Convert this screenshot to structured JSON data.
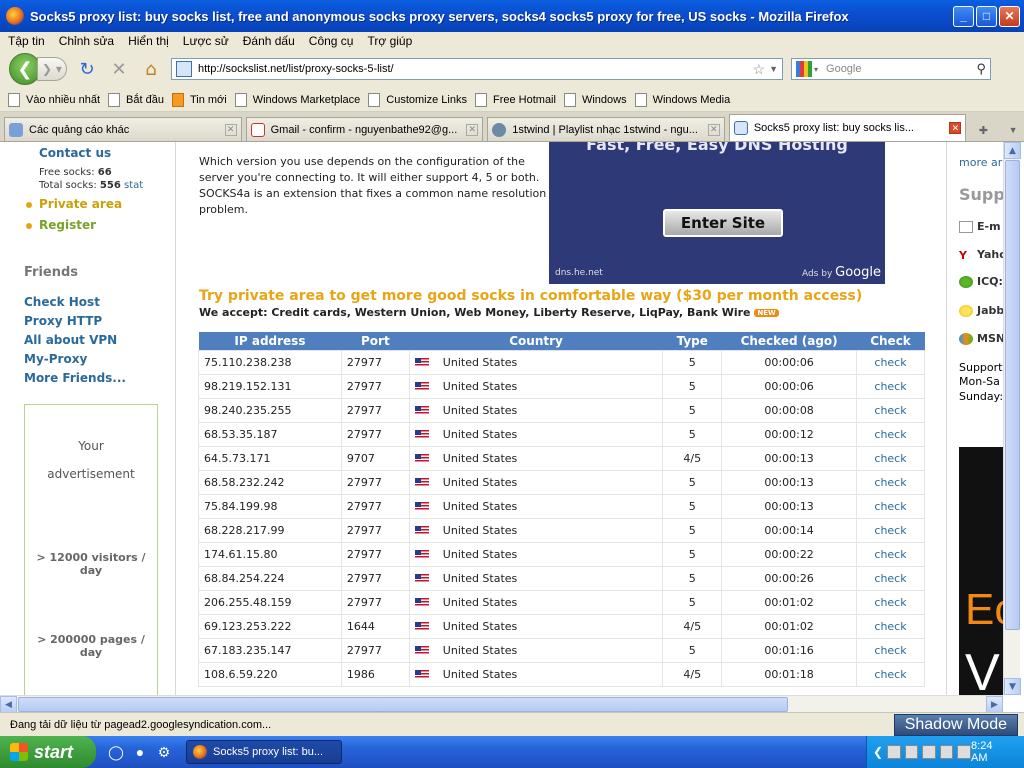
{
  "window": {
    "title": "Socks5 proxy list: buy socks list, free and anonymous socks proxy servers, socks4 socks5 proxy for free, US socks - Mozilla Firefox",
    "minimize": "_",
    "maximize": "□",
    "close": "✕"
  },
  "menu": [
    "Tập tin",
    "Chỉnh sửa",
    "Hiển thị",
    "Lược sử",
    "Đánh dấu",
    "Công cụ",
    "Trợ giúp"
  ],
  "nav": {
    "url": "http://sockslist.net/list/proxy-socks-5-list/",
    "search_placeholder": "Google"
  },
  "bookmarks": [
    "Vào nhiều nhất",
    "Bắt đầu",
    "Tin mới",
    "Windows Marketplace",
    "Customize Links",
    "Free Hotmail",
    "Windows",
    "Windows Media"
  ],
  "tabs": [
    {
      "label": "Các quảng cáo khác"
    },
    {
      "label": "Gmail - confirm - nguyenbathe92@g..."
    },
    {
      "label": "1stwind | Playlist nhạc 1stwind - ngu..."
    },
    {
      "label": "Socks5 proxy list: buy socks lis..."
    }
  ],
  "sidebar": {
    "contact": "Contact us",
    "free_socks_label": "Free socks:",
    "free_socks": "66",
    "total_socks_label": "Total socks:",
    "total_socks": "556",
    "stat": "stat",
    "private": "Private area",
    "register": "Register",
    "friends_title": "Friends",
    "friends": [
      "Check Host",
      "Proxy HTTP",
      "All about VPN",
      "My-Proxy",
      "More Friends..."
    ],
    "ad": {
      "line1": "Your",
      "line2": "advertisement",
      "visitors": "> 12000 visitors / day",
      "pages": "> 200000 pages / day"
    }
  },
  "main": {
    "desc": "Which version you use depends on the configuration of the server you're connecting to. It will either support 4, 5 or both. SOCKS4a is an extension that fixes a common name resolution problem.",
    "ad": {
      "headline": "Fast, Free, Easy DNS Hosting",
      "button": "Enter Site",
      "domain": "dns.he.net",
      "ads_by": "Ads by",
      "google": "Google"
    },
    "promo": "Try private area to get more good socks in comfortable way ($30 per month access)",
    "accept": "We accept: Credit cards, Western Union, Web Money, Liberty Reserve, LiqPay, Bank Wire",
    "new_badge": "NEW"
  },
  "table": {
    "headers": [
      "IP address",
      "Port",
      "Country",
      "Type",
      "Checked (ago)",
      "Check"
    ],
    "rows": [
      {
        "ip": "75.110.238.238",
        "port": "27977",
        "country": "United States",
        "type": "5",
        "checked": "00:00:06",
        "check": "check"
      },
      {
        "ip": "98.219.152.131",
        "port": "27977",
        "country": "United States",
        "type": "5",
        "checked": "00:00:06",
        "check": "check"
      },
      {
        "ip": "98.240.235.255",
        "port": "27977",
        "country": "United States",
        "type": "5",
        "checked": "00:00:08",
        "check": "check"
      },
      {
        "ip": "68.53.35.187",
        "port": "27977",
        "country": "United States",
        "type": "5",
        "checked": "00:00:12",
        "check": "check"
      },
      {
        "ip": "64.5.73.171",
        "port": "9707",
        "country": "United States",
        "type": "4/5",
        "checked": "00:00:13",
        "check": "check"
      },
      {
        "ip": "68.58.232.242",
        "port": "27977",
        "country": "United States",
        "type": "5",
        "checked": "00:00:13",
        "check": "check"
      },
      {
        "ip": "75.84.199.98",
        "port": "27977",
        "country": "United States",
        "type": "5",
        "checked": "00:00:13",
        "check": "check"
      },
      {
        "ip": "68.228.217.99",
        "port": "27977",
        "country": "United States",
        "type": "5",
        "checked": "00:00:14",
        "check": "check"
      },
      {
        "ip": "174.61.15.80",
        "port": "27977",
        "country": "United States",
        "type": "5",
        "checked": "00:00:22",
        "check": "check"
      },
      {
        "ip": "68.84.254.224",
        "port": "27977",
        "country": "United States",
        "type": "5",
        "checked": "00:00:26",
        "check": "check"
      },
      {
        "ip": "206.255.48.159",
        "port": "27977",
        "country": "United States",
        "type": "5",
        "checked": "00:01:02",
        "check": "check"
      },
      {
        "ip": "69.123.253.222",
        "port": "1644",
        "country": "United States",
        "type": "4/5",
        "checked": "00:01:02",
        "check": "check"
      },
      {
        "ip": "67.183.235.147",
        "port": "27977",
        "country": "United States",
        "type": "5",
        "checked": "00:01:16",
        "check": "check"
      },
      {
        "ip": "108.6.59.220",
        "port": "1986",
        "country": "United States",
        "type": "4/5",
        "checked": "00:01:18",
        "check": "check"
      }
    ]
  },
  "rightbar": {
    "more": "more ar",
    "support": "Supp",
    "items": [
      "E-m",
      "Yaho",
      "ICQ:",
      "Jabb",
      "MSN"
    ],
    "hours1": "Support",
    "hours2": "Mon-Sa",
    "hours3": "Sunday:",
    "banner_e": "Ec",
    "banner_v": "V"
  },
  "status": {
    "text": "Đang tải dữ liệu từ pagead2.googlesyndication.com...",
    "shadow_mode": "Shadow Mode"
  },
  "taskbar": {
    "start": "start",
    "item": "Socks5 proxy list: bu...",
    "clock": "8:24 AM"
  }
}
